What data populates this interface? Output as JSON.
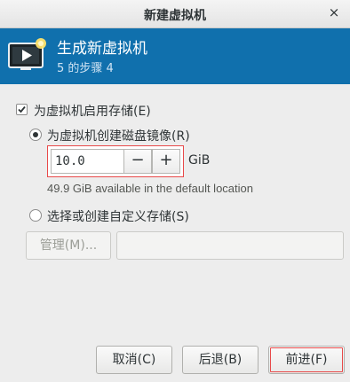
{
  "window": {
    "title": "新建虚拟机",
    "close_glyph": "×"
  },
  "header": {
    "title": "生成新虚拟机",
    "step": "5 的步骤 4",
    "icon": "monitor-play-icon"
  },
  "storage": {
    "enable_label": "为虚拟机启用存储(E)",
    "enable_checked": true,
    "create_label": "为虚拟机创建磁盘镜像(R)",
    "create_selected": true,
    "size_value": "10.0",
    "minus": "−",
    "plus": "+",
    "unit": "GiB",
    "available_text": "49.9 GiB available in the default location",
    "custom_label": "选择或创建自定义存储(S)",
    "custom_selected": false,
    "manage_label": "管理(M)...",
    "path_value": ""
  },
  "footer": {
    "cancel": "取消(C)",
    "back": "后退(B)",
    "forward": "前进(F)"
  },
  "colors": {
    "header_bg": "#1070ad",
    "highlight": "#e84a4a"
  }
}
